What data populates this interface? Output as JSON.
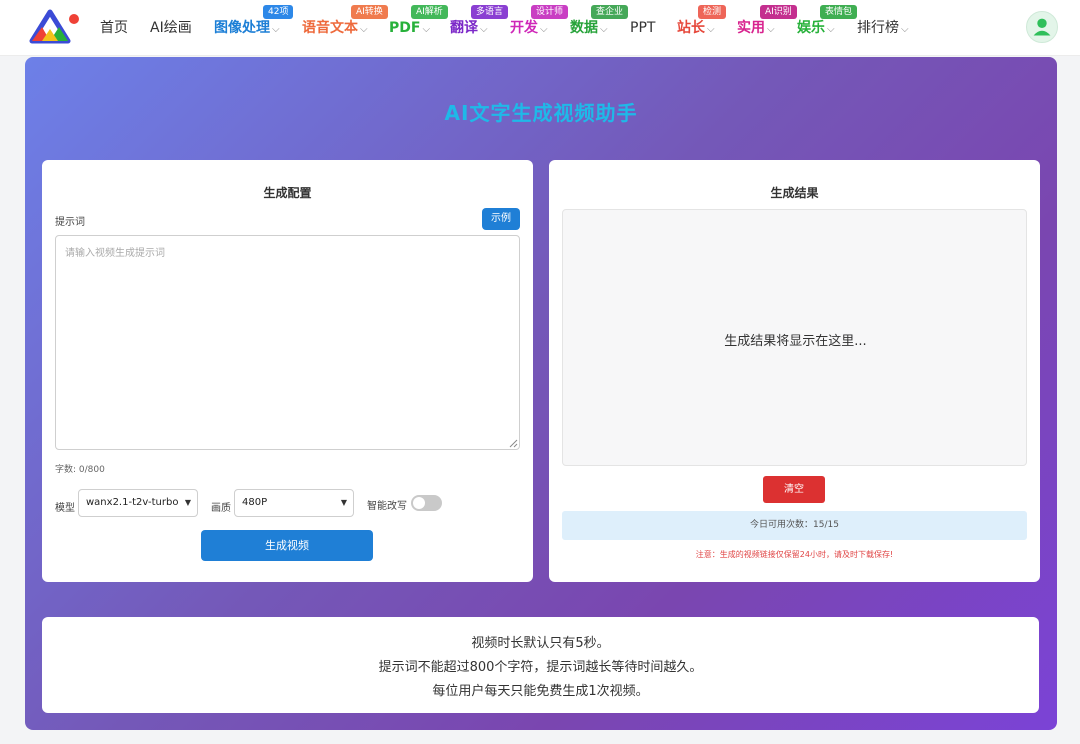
{
  "nav": {
    "items": [
      {
        "label": "首页",
        "color": "#333333",
        "plain": true
      },
      {
        "label": "AI绘画",
        "color": "#333333",
        "plain": true
      },
      {
        "label": "图像处理",
        "color": "#1d7fd6",
        "badge": "42项",
        "badge_color": "#2d88e8",
        "dropdown": true
      },
      {
        "label": "语音文本",
        "color": "#ee6a3c",
        "badge": "AI转换",
        "badge_color": "#f07b4e",
        "dropdown": true
      },
      {
        "label": "PDF",
        "color": "#27b13a",
        "badge": "AI解析",
        "badge_color": "#43b85a",
        "dropdown": true
      },
      {
        "label": "翻译",
        "color": "#7c28c8",
        "badge": "多语言",
        "badge_color": "#8a3fd2",
        "dropdown": true
      },
      {
        "label": "开发",
        "color": "#cf27b8",
        "badge": "设计师",
        "badge_color": "#c93ec3",
        "dropdown": true
      },
      {
        "label": "数据",
        "color": "#27a33a",
        "badge": "查企业",
        "badge_color": "#45a858",
        "dropdown": true
      },
      {
        "label": "PPT",
        "color": "#333333",
        "plain": true
      },
      {
        "label": "站长",
        "color": "#e6483b",
        "badge": "检测",
        "badge_color": "#ee6558",
        "dropdown": true
      },
      {
        "label": "实用",
        "color": "#d8228e",
        "badge": "AI识别",
        "badge_color": "#c42f8f",
        "dropdown": true
      },
      {
        "label": "娱乐",
        "color": "#27b13a",
        "badge": "表情包",
        "badge_color": "#3fae52",
        "dropdown": true
      },
      {
        "label": "排行榜",
        "color": "#333333",
        "plain": true,
        "dropdown": true
      }
    ],
    "chevron": "⌵",
    "logo_icon": "triangle-logo-icon",
    "avatar_icon": "user-avatar-icon"
  },
  "page": {
    "title": "AI文字生成视频助手"
  },
  "config": {
    "title": "生成配置",
    "prompt_label": "提示词",
    "example_label": "示例",
    "prompt_placeholder": "请输入视频生成提示词",
    "prompt_value": "",
    "char_count": "字数: 0/800",
    "model_label": "模型",
    "model_value": "wanx2.1-t2v-turbo",
    "quality_label": "画质",
    "quality_value": "480P",
    "smart_rewrite_label": "智能改写",
    "smart_rewrite_on": false,
    "generate_label": "生成视频"
  },
  "result": {
    "title": "生成结果",
    "placeholder": "生成结果将显示在这里...",
    "clear_label": "清空",
    "usage_text": "今日可用次数：15/15",
    "notice": "注意：生成的视频链接仅保留24小时，请及时下载保存!"
  },
  "info": {
    "lines": [
      "视频时长默认只有5秒。",
      "提示词不能超过800个字符，提示词越长等待时间越久。",
      "每位用户每天只能免费生成1次视频。"
    ]
  },
  "colors": {
    "accent": "#1f7fd6",
    "danger": "#dc3131",
    "title_cyan": "#1fb9e8",
    "gradient_start": "#6d80e8",
    "gradient_end": "#7b43d6"
  }
}
